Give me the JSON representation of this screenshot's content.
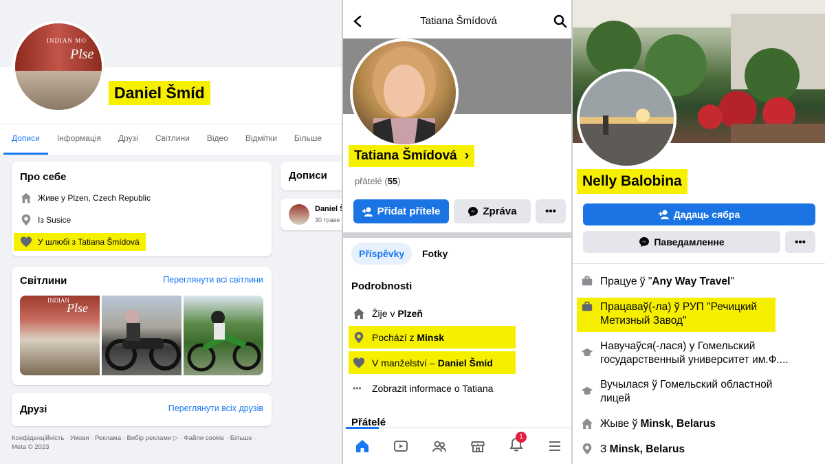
{
  "panel1": {
    "name": "Daniel Šmíd",
    "storefront": {
      "line1": "INDIAN MO",
      "line2": "Plse"
    },
    "tabs": [
      "Дописи",
      "Інформація",
      "Друзі",
      "Світлини",
      "Відео",
      "Відмітки",
      "Більше"
    ],
    "about": {
      "title": "Про себе",
      "lives_prefix": "Живе у ",
      "lives_place": "Plzen, Czech Republic",
      "from_prefix": "Із ",
      "from_place": "Susice",
      "married_prefix": "У шлюбі з ",
      "married_name": "Tatiana Šmídová"
    },
    "photos": {
      "title": "Світлини",
      "link": "Переглянути всі світлини",
      "photo1_text": "INDIAN",
      "photo1_script": "Plse"
    },
    "friends": {
      "title": "Друзі",
      "link": "Переглянути всіх друзів"
    },
    "posts": {
      "title": "Дописи",
      "author": "Daniel Š",
      "date": "30 траве"
    },
    "footer_line1": "Конфіденційність · Умови · Реклама · Вибір реклами ▷ · Файли cookie · Більше ·",
    "footer_line2": "Meta © 2023"
  },
  "panel2": {
    "title": "Tatiana Šmídová",
    "name": "Tatiana Šmídová",
    "friends_label": "přátelé",
    "friends_count": "55",
    "add_friend": "Přidat přítele",
    "message": "Zpráva",
    "tabs": [
      "Příspěvky",
      "Fotky"
    ],
    "details_title": "Podrobnosti",
    "lives_prefix": "Žije v ",
    "lives_place": "Plzeň",
    "from_prefix": "Pochází z ",
    "from_place": "Minsk",
    "married_prefix": "V manželství – ",
    "married_name": "Daniel Šmíd",
    "more_info": "Zobrazit informace o Tatiana",
    "friends_title": "Přátelé",
    "notification_count": "1"
  },
  "panel3": {
    "name": "Nelly Balobina",
    "add_friend": "Дадаць сябра",
    "message": "Паведамленне",
    "work1_prefix": "Працуе ў \"",
    "work1_place": "Any Way Travel",
    "work1_suffix": "\"",
    "work2_line1": "Працаваў(-ла) ў РУП \"Речицкий",
    "work2_line2": "Метизный Завод\"",
    "edu1_line1": "Навучаўся(-лася) у Гомельский",
    "edu1_line2": "государственный университет им.Ф....",
    "edu2_line1": "Вучылася ў Гомельский областной",
    "edu2_line2": "лицей",
    "lives_prefix": "Жыве ў ",
    "lives_place": "Minsk, Belarus",
    "from_prefix": "З ",
    "from_place": "Minsk, Belarus"
  },
  "colors": {
    "accent": "#1877f2",
    "highlight": "#f6ef00"
  }
}
